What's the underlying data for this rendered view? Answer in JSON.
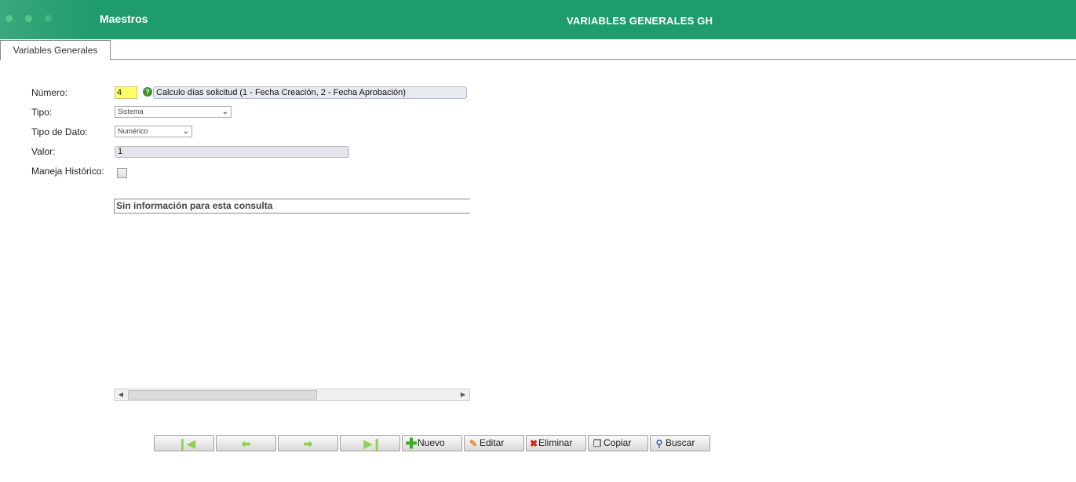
{
  "header": {
    "app_title": "Maestros",
    "page_title": "VARIABLES GENERALES GH",
    "brand_color": "#1f9c6b"
  },
  "tabs": [
    {
      "label": "Variables Generales",
      "active": true
    }
  ],
  "form": {
    "numero_label": "Número:",
    "numero_value": "4",
    "help_icon": "question-circle-icon",
    "descripcion_value": "Calculo días solicitud (1 - Fecha Creación, 2 - Fecha Aprobación)",
    "tipo_label": "Tipo:",
    "tipo_value": "Sistema",
    "tipo_dato_label": "Tipo de Dato:",
    "tipo_dato_value": "Numérico",
    "valor_label": "Valor:",
    "valor_value": "1",
    "maneja_historico_label": "Maneja Histórico:",
    "maneja_historico_checked": false
  },
  "grid": {
    "empty_message": "Sin información para esta consulta"
  },
  "toolbar": {
    "first_icon": "first-record-icon",
    "prev_icon": "previous-record-icon",
    "next_icon": "next-record-icon",
    "last_icon": "last-record-icon",
    "nuevo_label": "Nuevo",
    "editar_label": "Editar",
    "eliminar_label": "Eliminar",
    "copiar_label": "Copiar",
    "buscar_label": "Buscar"
  }
}
